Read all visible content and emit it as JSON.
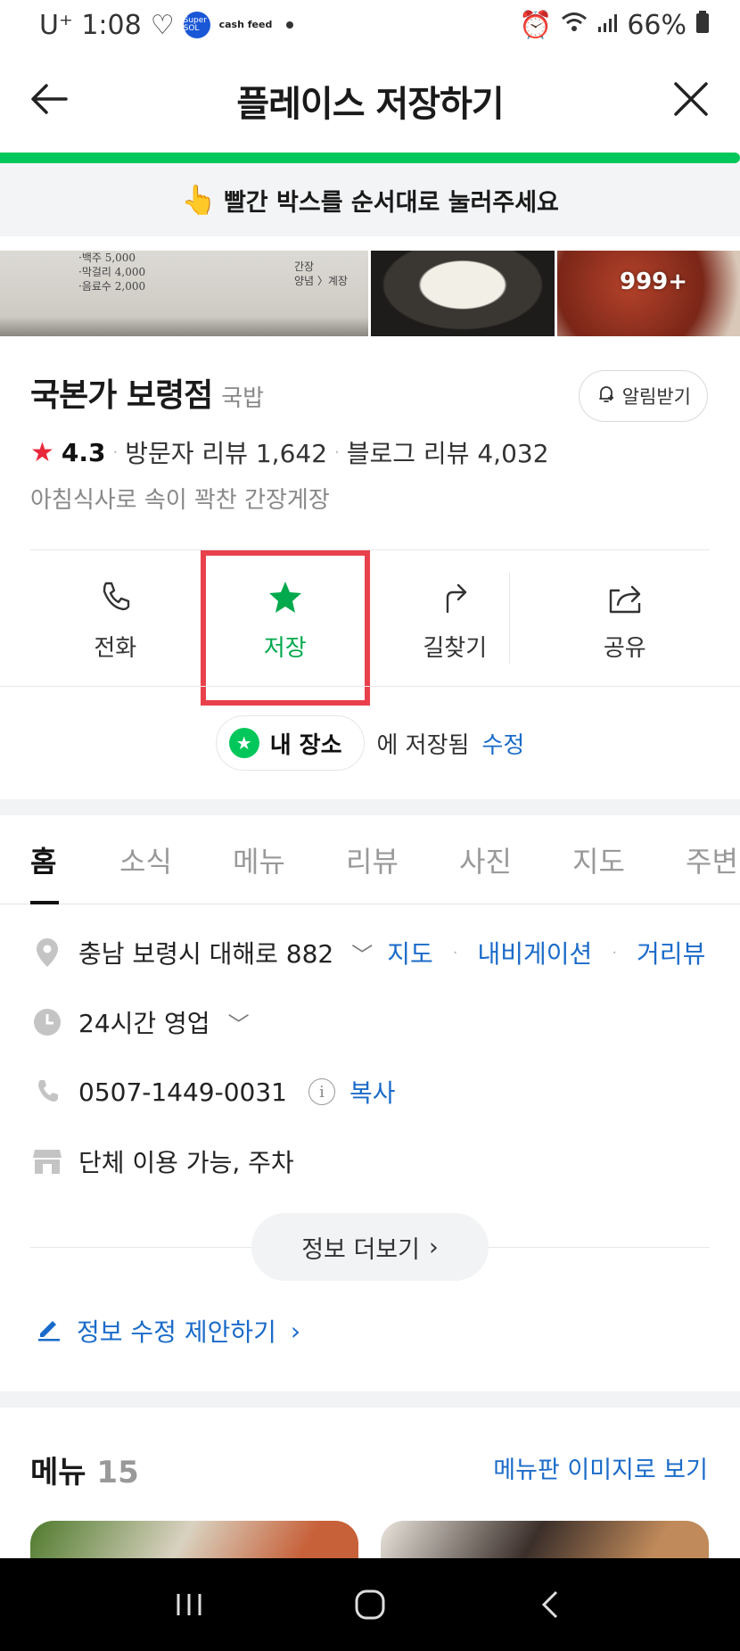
{
  "status_bar": {
    "carrier": "U⁺ 1:08",
    "badge": "Super SOL",
    "cash": "cash feed",
    "battery": "66%"
  },
  "header": {
    "title": "플레이스 저장하기"
  },
  "guide": {
    "hand": "👆",
    "text": "빨간 박스를 순서대로 눌러주세요"
  },
  "photos": {
    "menu_lines": [
      "·백주 5,000",
      "·막걸리 4,000",
      "·음료수 2,000"
    ],
    "menu_right": [
      "간장",
      "양념 〉계장"
    ],
    "count": "999+"
  },
  "place": {
    "name": "국본가 보령점",
    "category": "국밥",
    "alarm_label": "알림받기",
    "rating_star": "★",
    "rating": "4.3",
    "visitor_reviews": "방문자 리뷰 1,642",
    "blog_reviews": "블로그 리뷰 4,032",
    "description": "아침식사로 속이 꽉찬 간장게장"
  },
  "actions": {
    "call": "전화",
    "save": "저장",
    "directions": "길찾기",
    "share": "공유"
  },
  "saved": {
    "chip_label": "내 장소",
    "suffix": "에 저장됨",
    "edit": "수정"
  },
  "tabs": [
    "홈",
    "소식",
    "메뉴",
    "리뷰",
    "사진",
    "지도",
    "주변"
  ],
  "info": {
    "address": "충남 보령시 대해로 882",
    "address_links": [
      "지도",
      "내비게이션",
      "거리뷰"
    ],
    "hours": "24시간 영업",
    "phone": "0507-1449-0031",
    "phone_copy": "복사",
    "amenities": "단체 이용 가능, 주차",
    "more": "정보 더보기",
    "suggest_edit": "정보 수정 제안하기"
  },
  "menu_section": {
    "title": "메뉴",
    "count": "15",
    "link": "메뉴판 이미지로 보기"
  },
  "colors": {
    "brand_green": "#03c75a",
    "highlight_red": "#e8414b",
    "link_blue": "#1a6bc9",
    "rating_red": "#e8293b"
  }
}
